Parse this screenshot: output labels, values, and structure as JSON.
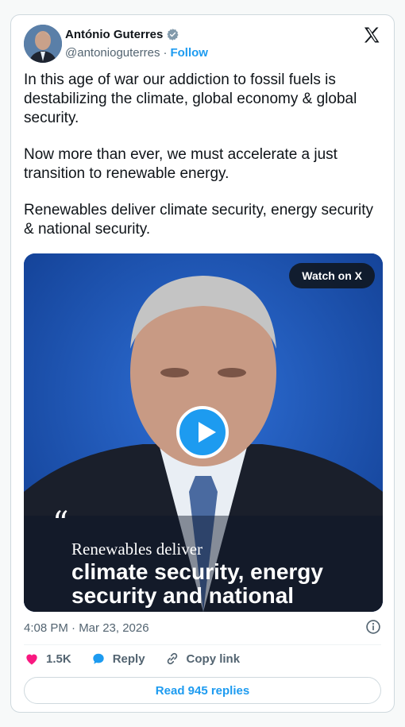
{
  "author": {
    "name": "António Guterres",
    "handle": "@antonioguterres",
    "separator": "·",
    "follow_label": "Follow"
  },
  "tweet": {
    "paragraphs": [
      "In this age of war our addiction to fossil fuels is destabilizing the climate, global economy & global security.",
      "Now more than ever, we must accelerate a just transition to renewable energy.",
      "Renewables deliver climate security, energy security & national security."
    ]
  },
  "media": {
    "watch_label": "Watch on X",
    "quote_mark": "“",
    "quote_lead": "Renewables deliver",
    "quote_main": "climate security, energy security and national"
  },
  "meta": {
    "timestamp": "4:08 PM · Mar 23, 2026"
  },
  "actions": {
    "likes": "1.5K",
    "reply_label": "Reply",
    "copy_link_label": "Copy link",
    "read_replies_label": "Read 945 replies"
  },
  "colors": {
    "accent": "#1d9bf0",
    "like": "#f91880",
    "text": "#0f1419",
    "muted": "#536471"
  },
  "icons": [
    "verified-badge-icon",
    "x-logo-icon",
    "play-icon",
    "info-icon",
    "heart-icon",
    "reply-bubble-icon",
    "link-icon"
  ]
}
